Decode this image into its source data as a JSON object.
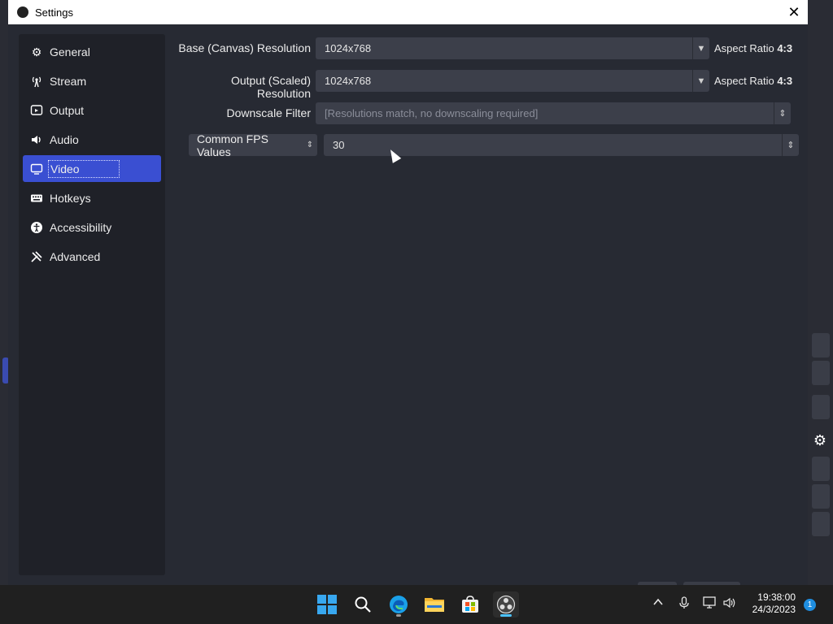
{
  "window": {
    "title": "Settings"
  },
  "sidebar": {
    "items": [
      {
        "label": "General",
        "icon": "gear-icon"
      },
      {
        "label": "Stream",
        "icon": "broadcast-icon"
      },
      {
        "label": "Output",
        "icon": "output-icon"
      },
      {
        "label": "Audio",
        "icon": "speaker-icon"
      },
      {
        "label": "Video",
        "icon": "monitor-icon",
        "active": true
      },
      {
        "label": "Hotkeys",
        "icon": "keyboard-icon"
      },
      {
        "label": "Accessibility",
        "icon": "accessibility-icon"
      },
      {
        "label": "Advanced",
        "icon": "tools-icon"
      }
    ]
  },
  "video": {
    "base_label": "Base (Canvas) Resolution",
    "base_value": "1024x768",
    "base_aspect_prefix": "Aspect Ratio",
    "base_aspect": "4:3",
    "output_label": "Output (Scaled) Resolution",
    "output_value": "1024x768",
    "output_aspect_prefix": "Aspect Ratio",
    "output_aspect": "4:3",
    "downscale_label": "Downscale Filter",
    "downscale_value": "[Resolutions match, no downscaling required]",
    "fps_type": "Common FPS Values",
    "fps_value": "30"
  },
  "taskbar": {
    "time": "19:38:00",
    "date": "24/3/2023",
    "notifications": "1"
  },
  "colors": {
    "accent": "#3a4fd2",
    "panel": "#272a33",
    "sidebar": "#1f2128",
    "field": "#3c3f4a"
  }
}
